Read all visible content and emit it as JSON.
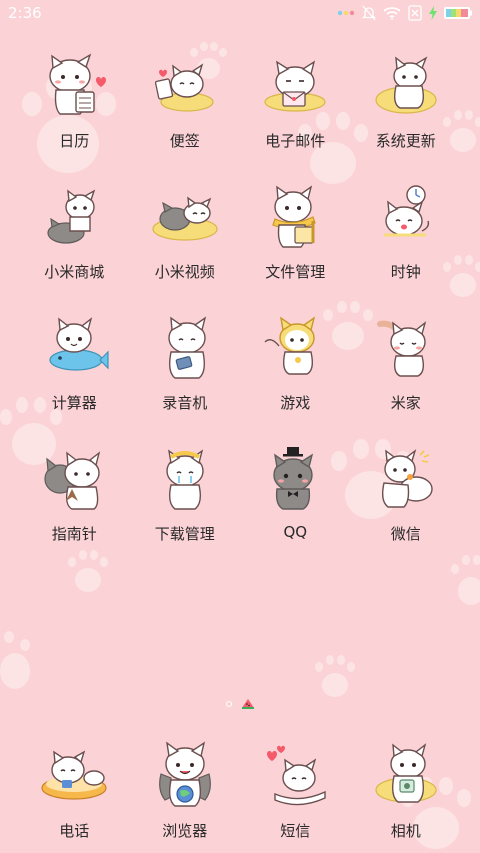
{
  "status_bar": {
    "time": "2:36",
    "icons": [
      "notification-dots-icon",
      "do-not-disturb-icon",
      "wifi-icon",
      "sim-absent-icon",
      "charging-icon",
      "battery-icon"
    ]
  },
  "home_screen": {
    "pager": {
      "page_count": 2,
      "current_page": 2
    },
    "apps": [
      {
        "label": "日历",
        "icon": "calendar-cat-icon"
      },
      {
        "label": "便签",
        "icon": "notes-cat-icon"
      },
      {
        "label": "电子邮件",
        "icon": "email-cat-icon"
      },
      {
        "label": "系统更新",
        "icon": "system-update-cat-icon"
      },
      {
        "label": "小米商城",
        "icon": "mi-store-cat-icon"
      },
      {
        "label": "小米视频",
        "icon": "mi-video-cat-icon"
      },
      {
        "label": "文件管理",
        "icon": "file-manager-cat-icon"
      },
      {
        "label": "时钟",
        "icon": "clock-cat-icon"
      },
      {
        "label": "计算器",
        "icon": "calculator-cat-icon"
      },
      {
        "label": "录音机",
        "icon": "recorder-cat-icon"
      },
      {
        "label": "游戏",
        "icon": "games-cat-icon"
      },
      {
        "label": "米家",
        "icon": "mi-home-cat-icon"
      },
      {
        "label": "指南针",
        "icon": "compass-cat-icon"
      },
      {
        "label": "下载管理",
        "icon": "downloads-cat-icon"
      },
      {
        "label": "QQ",
        "icon": "qq-cat-icon"
      },
      {
        "label": "微信",
        "icon": "wechat-cat-icon"
      }
    ],
    "dock": [
      {
        "label": "电话",
        "icon": "phone-cat-icon"
      },
      {
        "label": "浏览器",
        "icon": "browser-cat-icon"
      },
      {
        "label": "短信",
        "icon": "messages-cat-icon"
      },
      {
        "label": "相机",
        "icon": "camera-cat-icon"
      }
    ]
  },
  "colors": {
    "wallpaper": "#fbd3d6",
    "label_text": "#2a2a2a",
    "cat_white": "#ffffff",
    "cat_outline": "#6b4f4f",
    "cat_grey": "#8d8a88",
    "cushion_yellow": "#f6dd7a",
    "blush": "#f7a4a4",
    "accent_blue": "#6cc4ea",
    "accent_pink": "#f28b99"
  }
}
